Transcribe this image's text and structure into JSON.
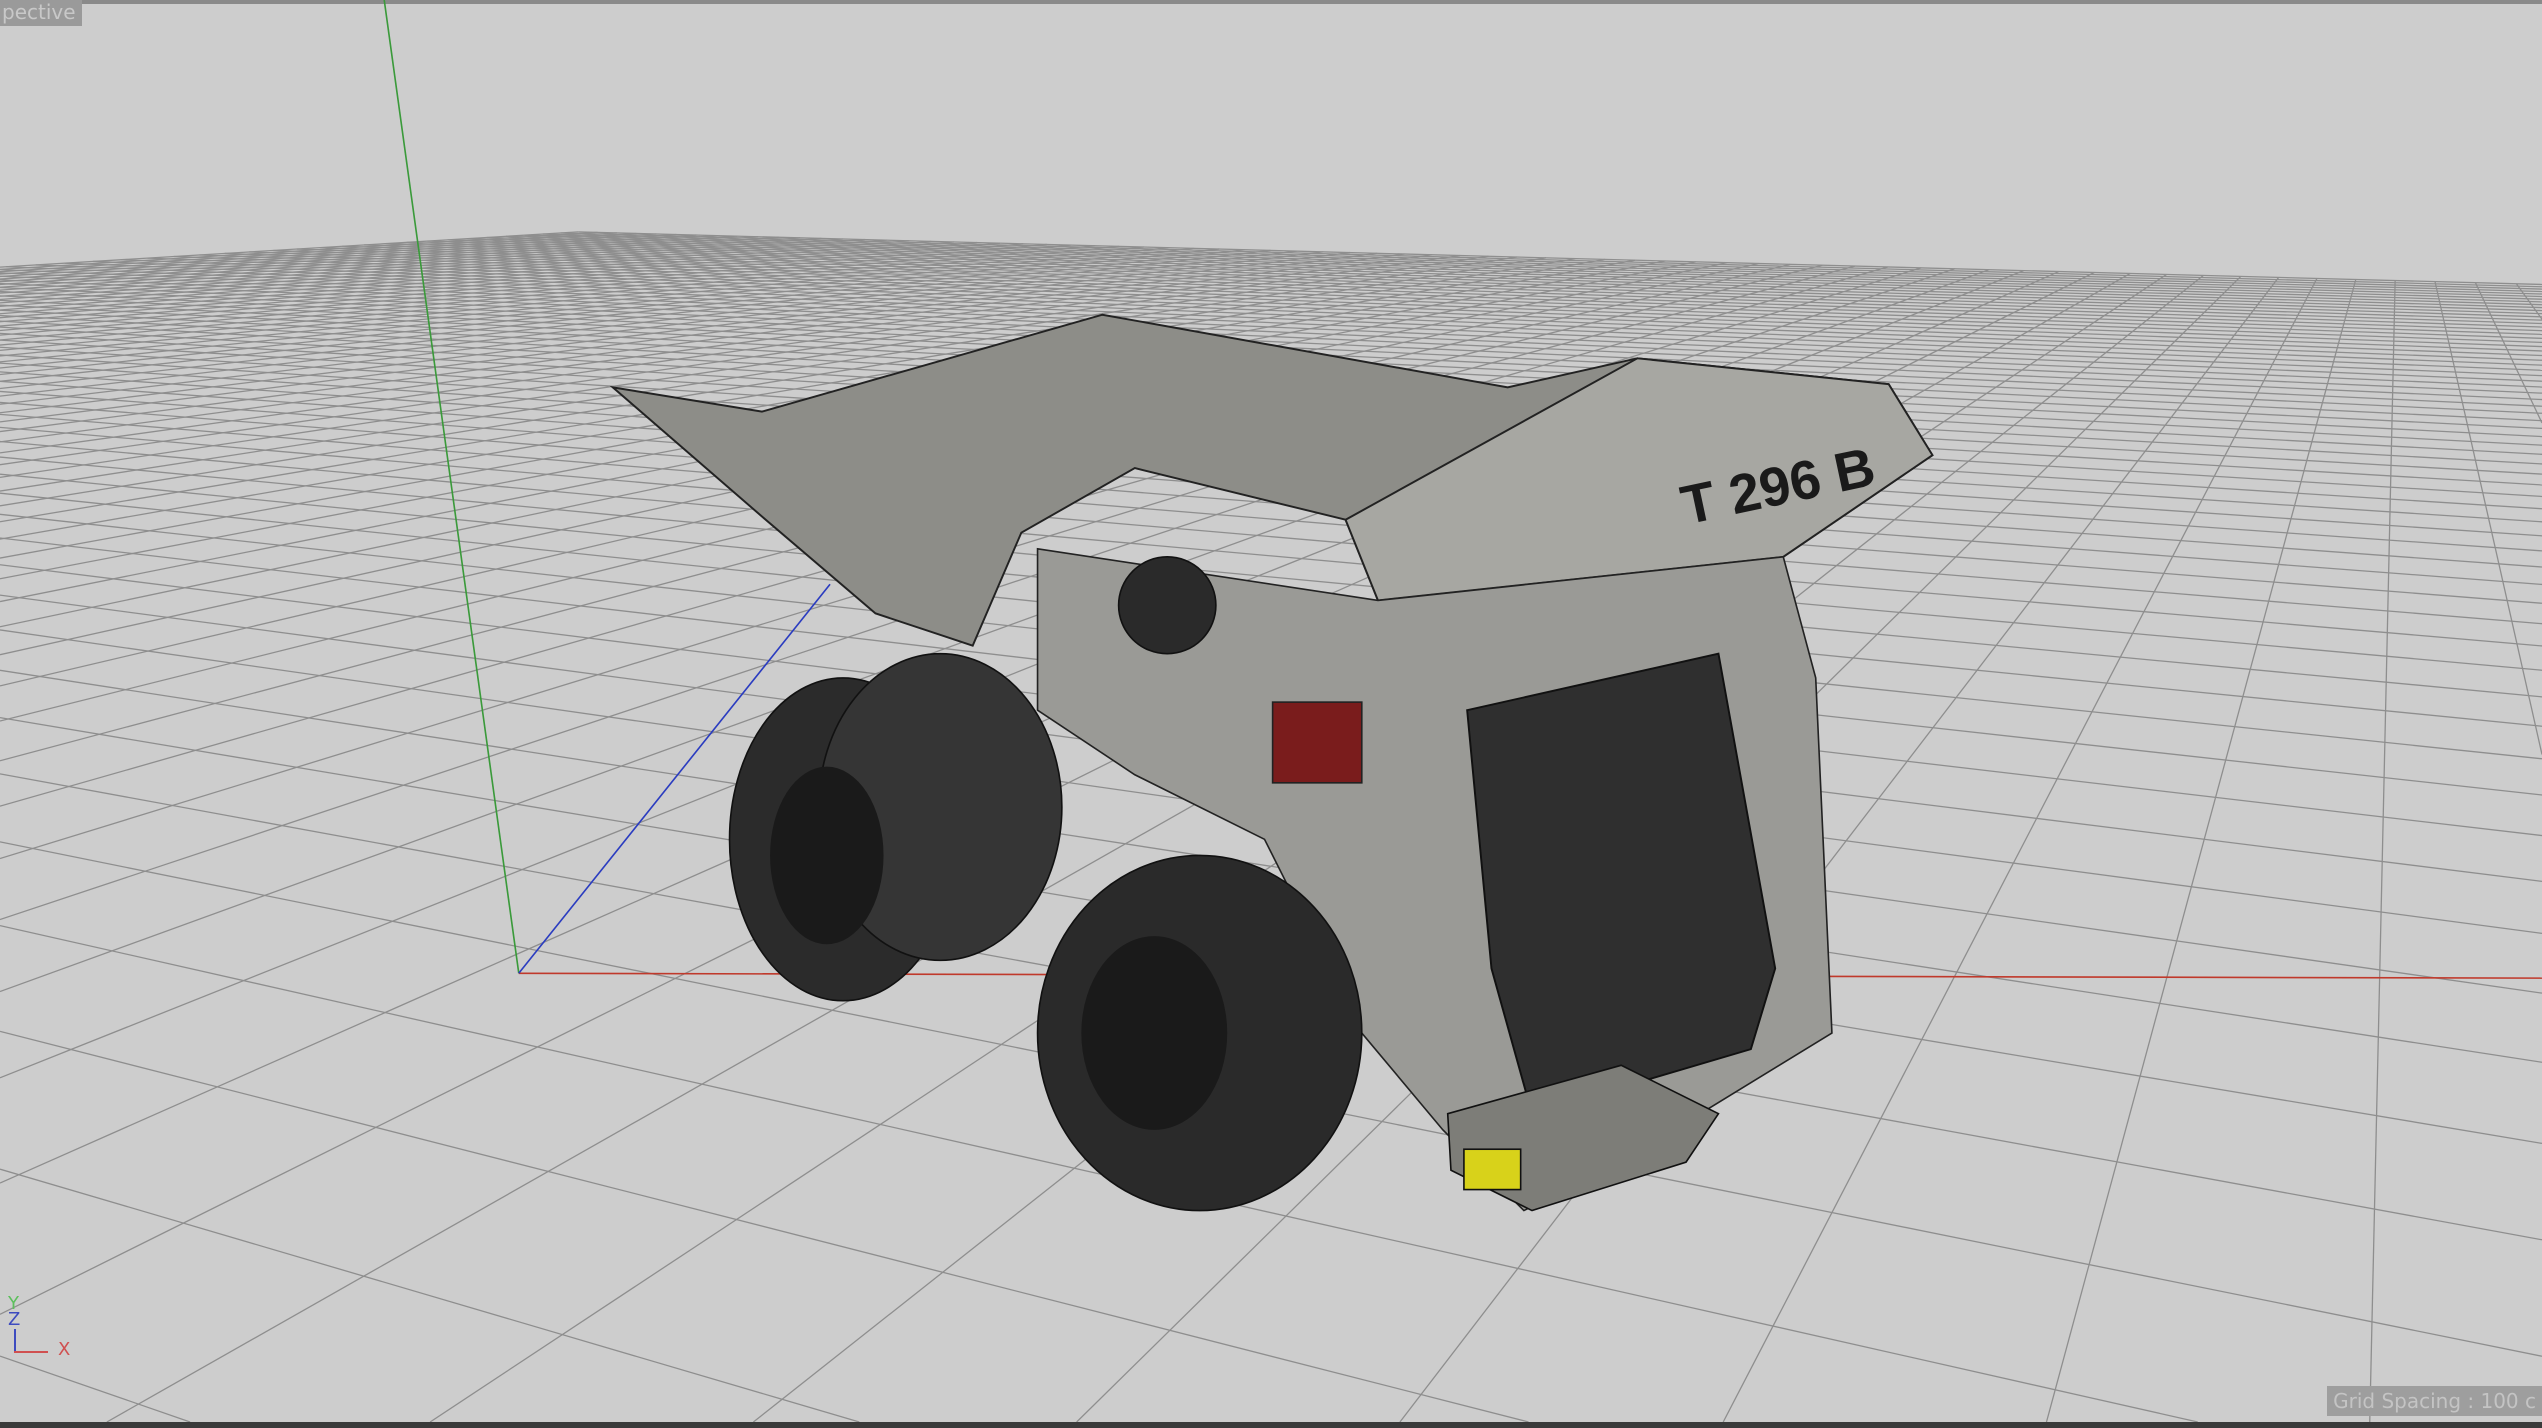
{
  "viewport": {
    "label": "pective",
    "grid_spacing": "Grid Spacing : 100 c",
    "model_label": "T 296 B",
    "axis_labels": {
      "x": "X",
      "y": "Y",
      "z": "Z"
    },
    "colors": {
      "x_axis": "#c0392b",
      "y_axis": "#3a9a3a",
      "z_axis": "#2a3cc0",
      "grid": "#8e8e8e",
      "background": "#cdcdcd"
    }
  }
}
